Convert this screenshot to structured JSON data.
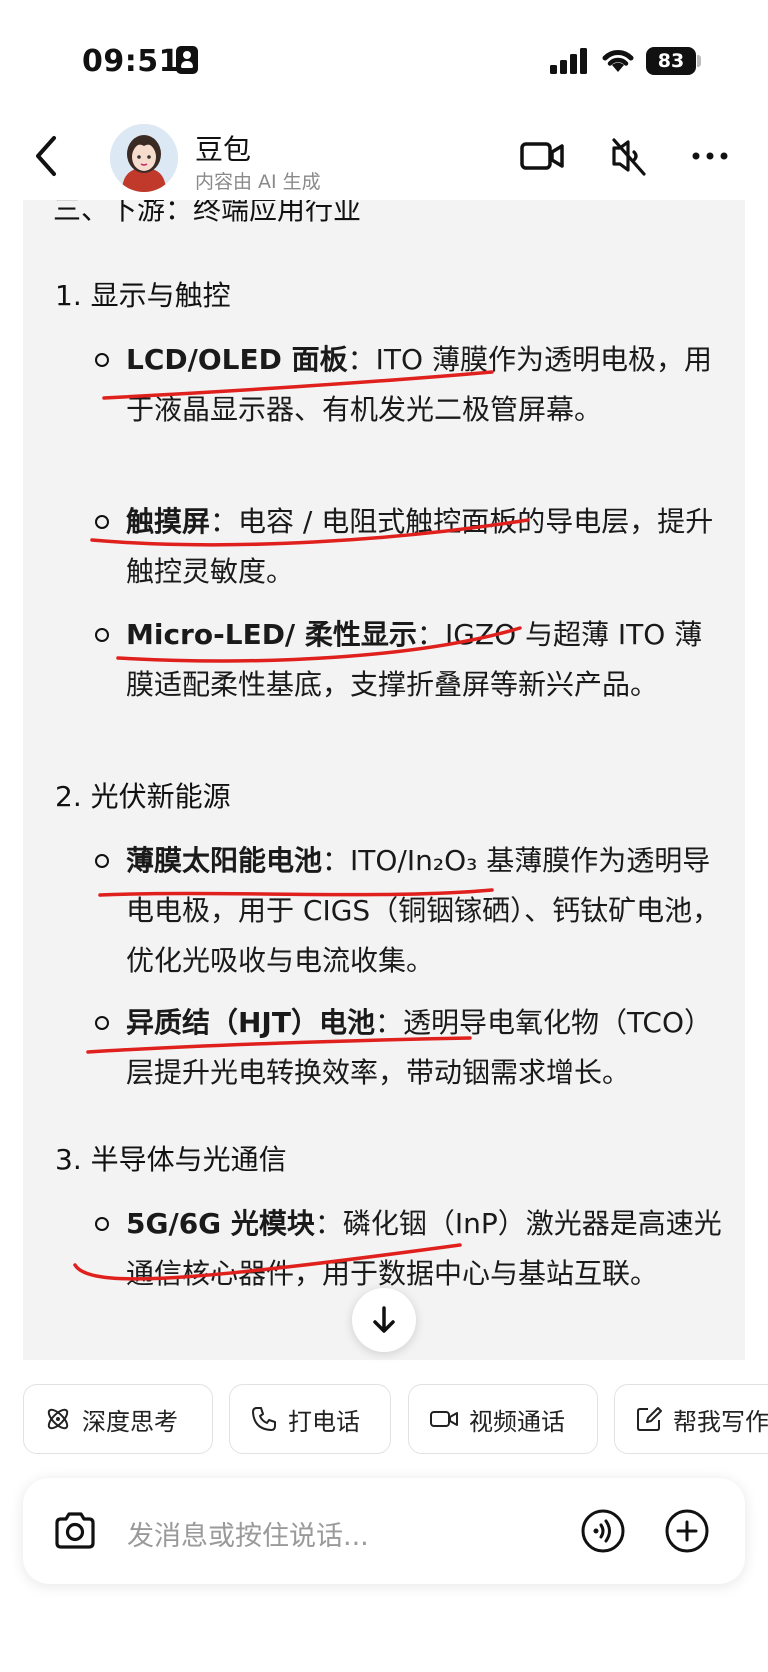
{
  "status_bar": {
    "time": "09:51",
    "battery": "83"
  },
  "header": {
    "name": "豆包",
    "subtitle": "内容由 AI 生成"
  },
  "message": {
    "section_title": "三、下游：终端应用行业",
    "groups": [
      {
        "heading": "1. 显示与触控",
        "items": [
          {
            "term": "LCD/OLED 面板",
            "sep": "：",
            "desc": "ITO 薄膜作为透明电极，用于液晶显示器、有机发光二极管屏幕。"
          },
          {
            "term": "触摸屏",
            "sep": "：",
            "desc": "电容 / 电阻式触控面板的导电层，提升触控灵敏度。"
          },
          {
            "term": "Micro-LED/ 柔性显示",
            "sep": "：",
            "desc": "IGZO 与超薄 ITO 薄膜适配柔性基底，支撑折叠屏等新兴产品。"
          }
        ]
      },
      {
        "heading": "2. 光伏新能源",
        "items": [
          {
            "term": "薄膜太阳能电池",
            "sep": "：",
            "desc": "ITO/In₂O₃ 基薄膜作为透明导电电极，用于 CIGS（铜铟镓硒）、钙钛矿电池，优化光吸收与电流收集。"
          },
          {
            "term": "异质结（HJT）电池",
            "sep": "：",
            "desc": "透明导电氧化物（TCO）层提升光电转换效率，带动铟需求增长。"
          }
        ]
      },
      {
        "heading": "3. 半导体与光通信",
        "items": [
          {
            "term": "5G/6G 光模块",
            "sep": "：",
            "desc": "磷化铟（InP）激光器是高速光通信核心器件，用于数据中心与基站互联。"
          }
        ]
      }
    ]
  },
  "quick_actions": [
    {
      "label": "深度思考",
      "icon": "atom-icon"
    },
    {
      "label": "打电话",
      "icon": "phone-icon"
    },
    {
      "label": "视频通话",
      "icon": "video-icon"
    },
    {
      "label": "帮我写作",
      "icon": "edit-icon"
    }
  ],
  "input": {
    "placeholder": "发消息或按住说话..."
  },
  "colors": {
    "card_bg": "#f3f3f4",
    "annotation_red": "#e0201d",
    "text": "#111111"
  }
}
